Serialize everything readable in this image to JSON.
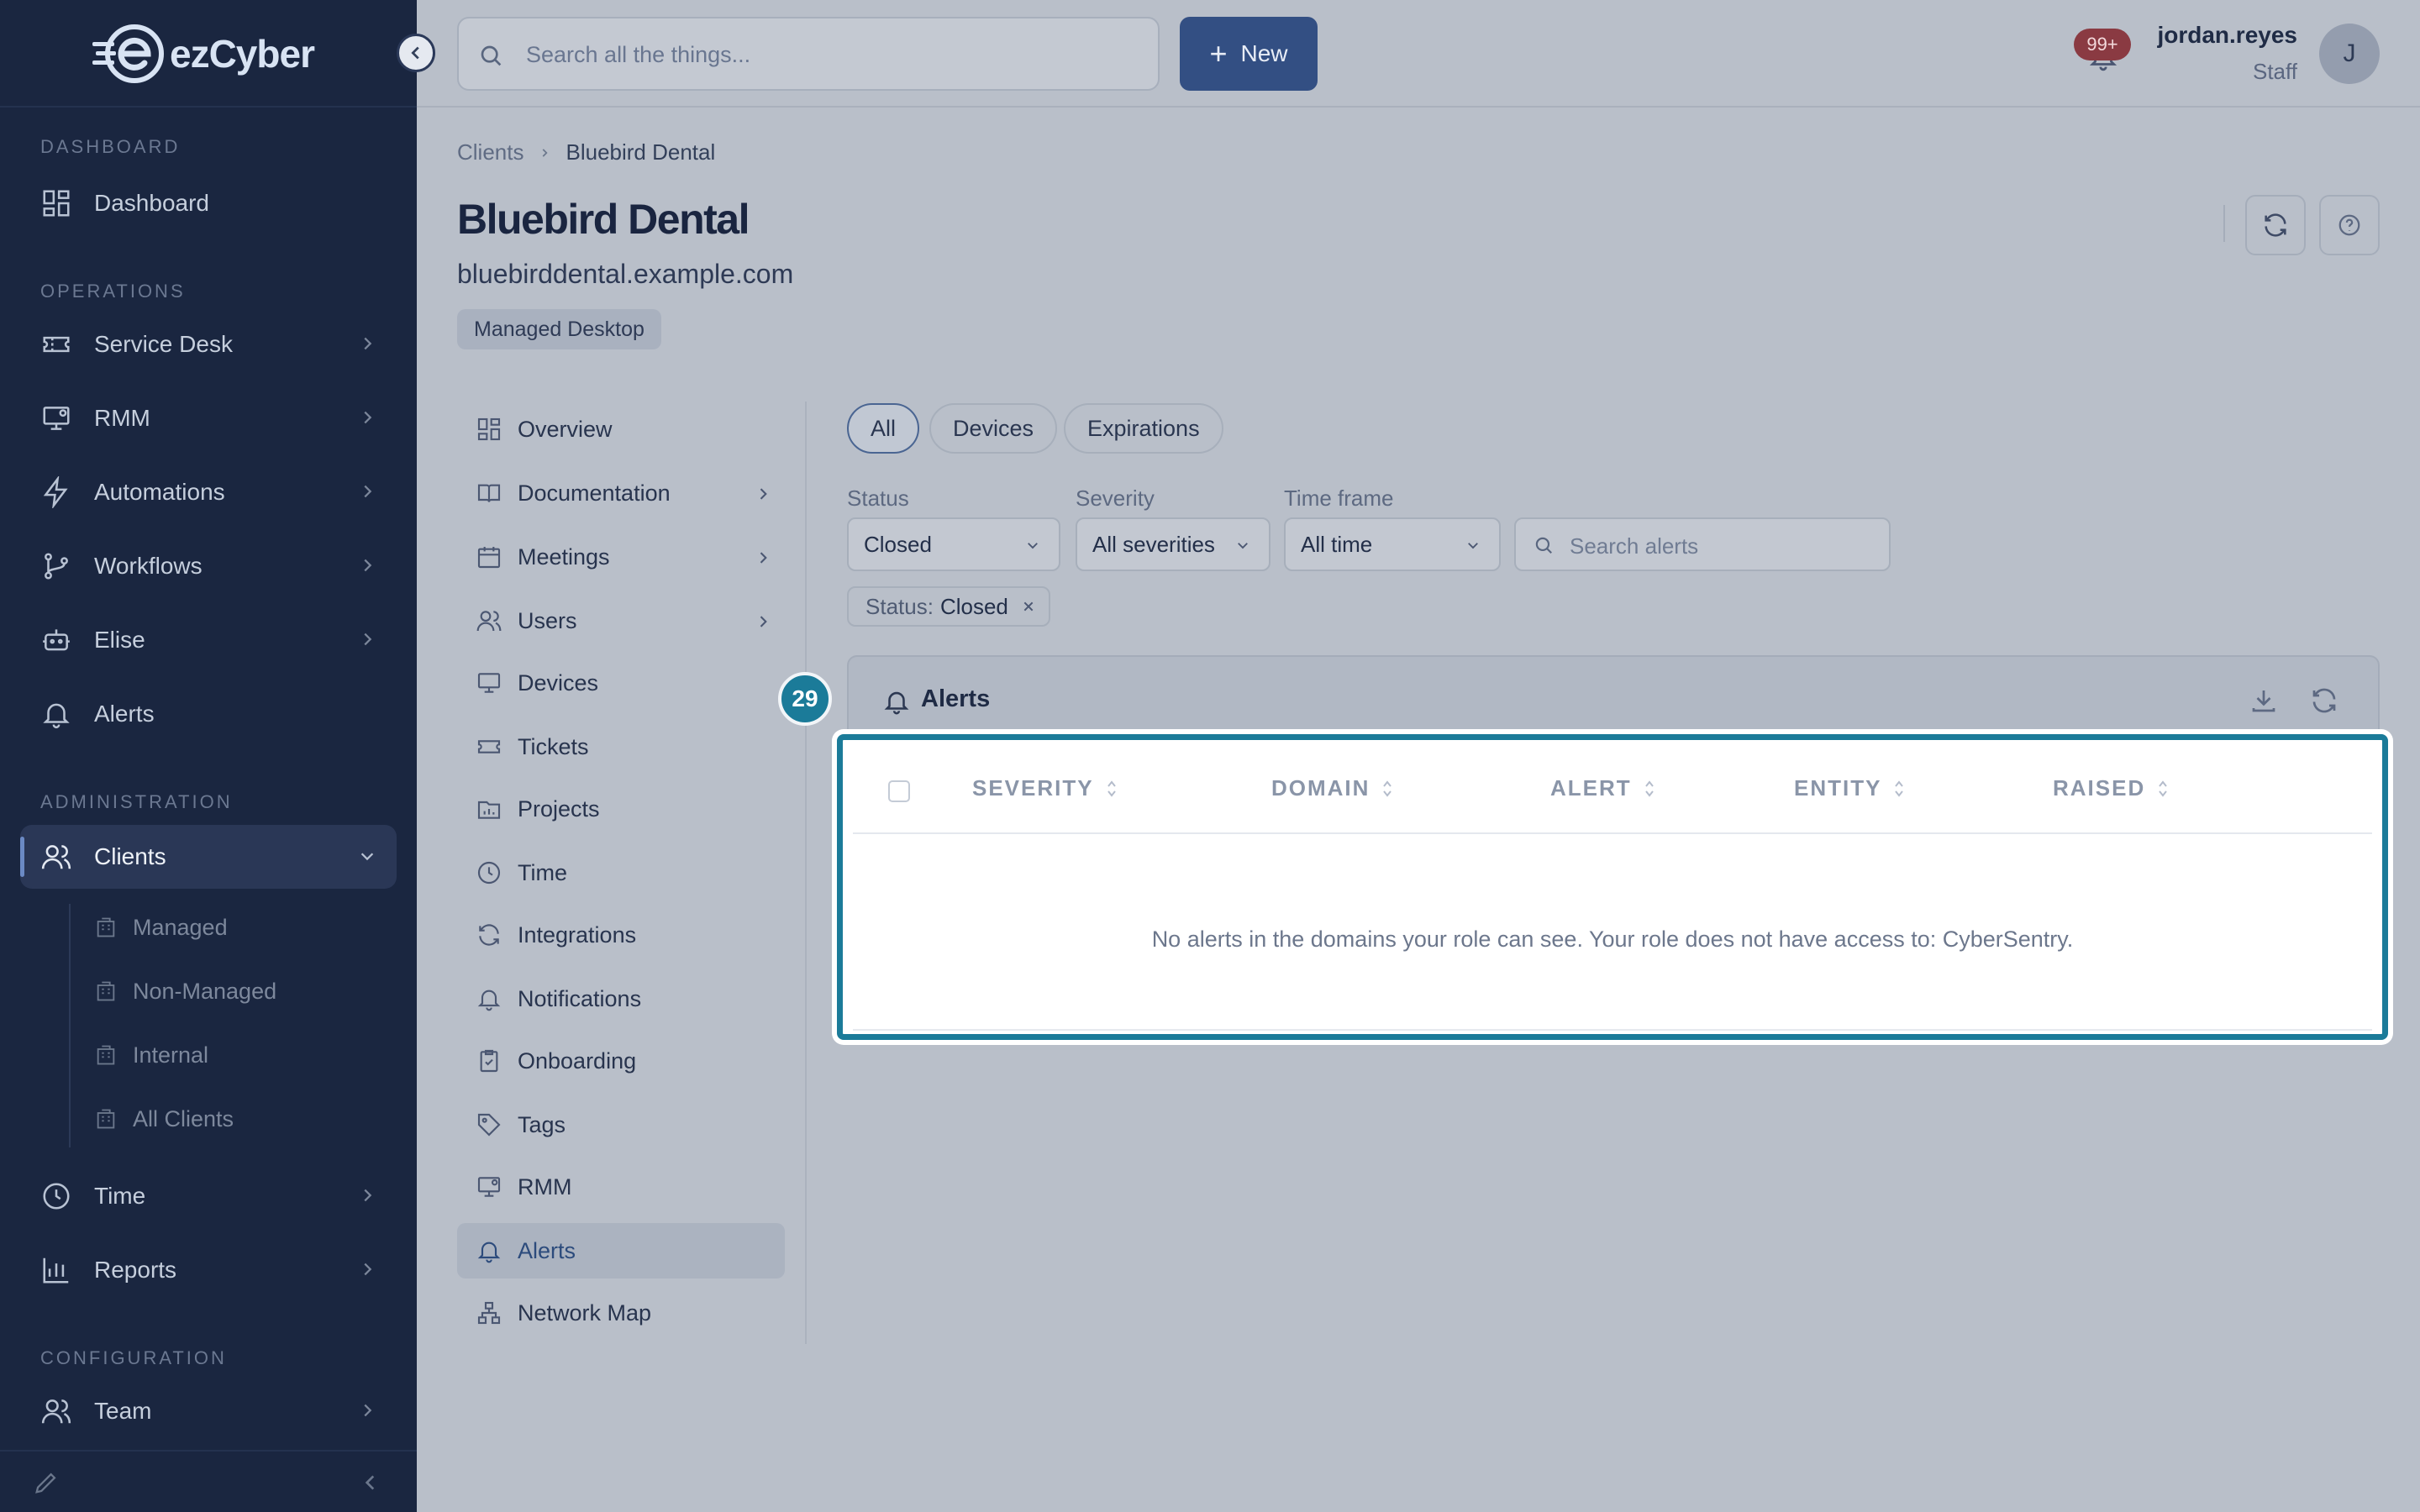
{
  "app": {
    "brand": "ezCyber"
  },
  "sidebar": {
    "sections": [
      {
        "label": "DASHBOARD"
      },
      {
        "label": "OPERATIONS"
      },
      {
        "label": "ADMINISTRATION"
      },
      {
        "label": "CONFIGURATION"
      }
    ],
    "items": [
      {
        "label": "Dashboard",
        "icon": "dashboard-icon"
      },
      {
        "label": "Service Desk",
        "icon": "ticket-icon"
      },
      {
        "label": "RMM",
        "icon": "monitor-gear-icon"
      },
      {
        "label": "Automations",
        "icon": "lightning-icon"
      },
      {
        "label": "Workflows",
        "icon": "workflow-icon"
      },
      {
        "label": "Elise",
        "icon": "robot-icon"
      },
      {
        "label": "Alerts",
        "icon": "bell-icon"
      },
      {
        "label": "Clients",
        "icon": "users-icon"
      },
      {
        "label": "Time",
        "icon": "clock-icon"
      },
      {
        "label": "Reports",
        "icon": "bar-chart-icon"
      },
      {
        "label": "Team",
        "icon": "team-icon"
      }
    ],
    "clients_sub": [
      {
        "label": "Managed",
        "icon": "building-icon"
      },
      {
        "label": "Non-Managed",
        "icon": "building-icon"
      },
      {
        "label": "Internal",
        "icon": "building-icon"
      },
      {
        "label": "All Clients",
        "icon": "building-icon"
      }
    ]
  },
  "topbar": {
    "search_placeholder": "Search all the things...",
    "new_label": "New",
    "notifications_badge": "99+",
    "user_name": "jordan.reyes",
    "user_role": "Staff",
    "avatar_initial": "J"
  },
  "page": {
    "breadcrumb": [
      "Clients",
      "Bluebird Dental"
    ],
    "title": "Bluebird Dental",
    "domain": "bluebirddental.example.com",
    "plan": "Managed Desktop"
  },
  "subnav": {
    "items": [
      {
        "label": "Overview",
        "icon": "grid-icon"
      },
      {
        "label": "Documentation",
        "icon": "book-icon"
      },
      {
        "label": "Meetings",
        "icon": "calendar-icon"
      },
      {
        "label": "Users",
        "icon": "users-icon"
      },
      {
        "label": "Devices",
        "icon": "monitor-icon"
      },
      {
        "label": "Tickets",
        "icon": "ticket-icon"
      },
      {
        "label": "Projects",
        "icon": "folder-chart-icon"
      },
      {
        "label": "Time",
        "icon": "clock-icon"
      },
      {
        "label": "Integrations",
        "icon": "refresh-icon"
      },
      {
        "label": "Notifications",
        "icon": "bell-icon"
      },
      {
        "label": "Onboarding",
        "icon": "clipboard-check-icon"
      },
      {
        "label": "Tags",
        "icon": "tag-icon"
      },
      {
        "label": "RMM",
        "icon": "monitor-gear-icon"
      },
      {
        "label": "Alerts",
        "icon": "bell-icon"
      },
      {
        "label": "Network Map",
        "icon": "network-icon"
      }
    ],
    "active": "Alerts"
  },
  "filters": {
    "segments": [
      "All",
      "Devices",
      "Expirations"
    ],
    "active_segment": "All",
    "status_label": "Status",
    "status_value": "Closed",
    "severity_label": "Severity",
    "severity_value": "All severities",
    "timeframe_label": "Time frame",
    "timeframe_value": "All time",
    "search_placeholder": "Search alerts",
    "chip_key": "Status:",
    "chip_value": "Closed"
  },
  "alerts_card": {
    "title": "Alerts",
    "step_badge": "29",
    "columns": [
      "SEVERITY",
      "DOMAIN",
      "ALERT",
      "ENTITY",
      "RAISED"
    ],
    "empty_message": "No alerts in the domains your role can see. Your role does not have access to: CyberSentry."
  }
}
